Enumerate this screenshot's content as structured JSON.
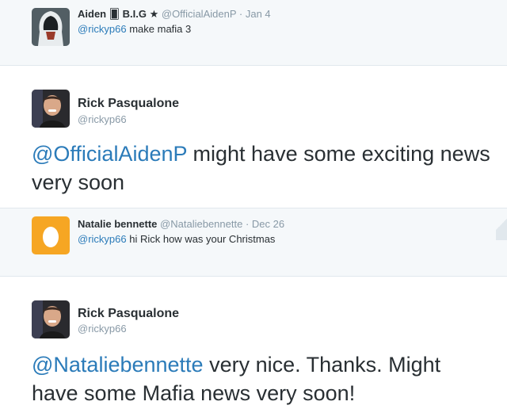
{
  "tweets": [
    {
      "style": "reply",
      "name": "Aiden 🂠 B.I.G ★",
      "handle": "@OfficialAidenP",
      "date": "Jan 4",
      "mention": "@rickyp66",
      "text": " make mafia 3",
      "avatar_icon": "hooded-assassin-avatar-icon"
    },
    {
      "style": "expanded",
      "name": "Rick Pasqualone",
      "handle": "@rickyp66",
      "mention": "@OfficialAidenP",
      "text": " might have some exciting news very soon",
      "avatar_icon": "man-portrait-avatar-icon"
    },
    {
      "style": "reply",
      "name": "Natalie bennette",
      "handle": "@Nataliebennette",
      "date": "Dec 26",
      "mention": "@rickyp66",
      "text": " hi Rick how was your Christmas",
      "avatar_icon": "default-egg-avatar-icon"
    },
    {
      "style": "expanded",
      "name": "Rick Pasqualone",
      "handle": "@rickyp66",
      "mention": "@Nataliebennette",
      "text": " very nice. Thanks. Might have some Mafia news very soon!",
      "avatar_icon": "man-portrait-avatar-icon"
    }
  ],
  "separator": "·",
  "colors": {
    "link": "#2b7bb9",
    "muted": "#8899a6",
    "reply_bg": "#f5f8fa",
    "egg_bg": "#f6a623"
  }
}
